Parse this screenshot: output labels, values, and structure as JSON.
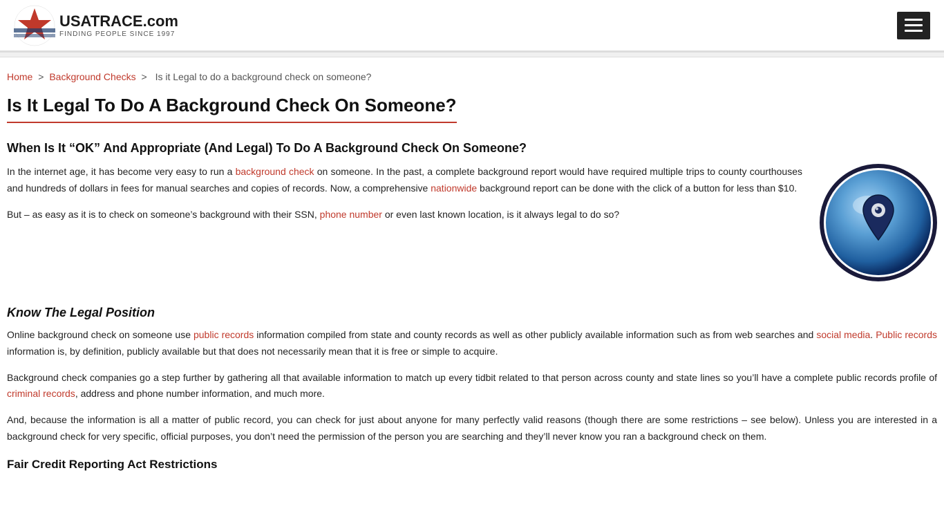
{
  "header": {
    "logo_text": "USATRACE.com",
    "logo_sub": "FINDING PEOPLE SINCE 1997",
    "menu_button_label": "Menu"
  },
  "breadcrumb": {
    "home": "Home",
    "background_checks": "Background Checks",
    "current": "Is it Legal to do a background check on someone?"
  },
  "page": {
    "title": "Is It Legal To Do A Background Check On Someone?",
    "section1_heading": "When Is It “OK” And Appropriate (And Legal) To Do A Background Check On Someone?",
    "paragraph1_part1": "In the internet age, it has become very easy to run a ",
    "paragraph1_link1": "background check",
    "paragraph1_part2": " on someone. In the past, a complete background report would have required multiple trips to county courthouses and hundreds of dollars in fees for manual searches and copies of records. Now, a comprehensive ",
    "paragraph1_link2": "nationwide",
    "paragraph1_part3": " background report can be done with the click of a button for less than $10.",
    "paragraph2_part1": "But – as easy as it is to check on someone’s background with their SSN, ",
    "paragraph2_link1": "phone number",
    "paragraph2_part2": " or even last known location, is it always legal to do so?",
    "section2_title": "Know The Legal Position",
    "section2_para1_part1": "Online background check on someone use ",
    "section2_para1_link1": "public records",
    "section2_para1_part2": " information compiled from state and county records as well as other publicly available information such as from web searches and ",
    "section2_para1_link2": "social media",
    "section2_para1_part3": ".  ",
    "section2_para1_link3": "Public records",
    "section2_para1_part4": " information is, by definition, publicly available but that does not necessarily mean that it is free or simple to acquire.",
    "section2_para2_part1": "Background check companies go a step further by gathering all that available information to match up every tidbit related to that person across county and state lines so you’ll have a complete public records profile of ",
    "section2_para2_link1": "criminal records",
    "section2_para2_part2": ", address and phone number information, and much more.",
    "section2_para3": "And, because the information is all a matter of public record, you can check for just about anyone for many perfectly valid reasons (though there are some restrictions – see below). Unless you are interested in a background check for very specific, official purposes, you don’t need the permission of the person you are searching and they’ll never know you ran a background check on them.",
    "section3_title": "Fair Credit Reporting Act Restrictions"
  }
}
